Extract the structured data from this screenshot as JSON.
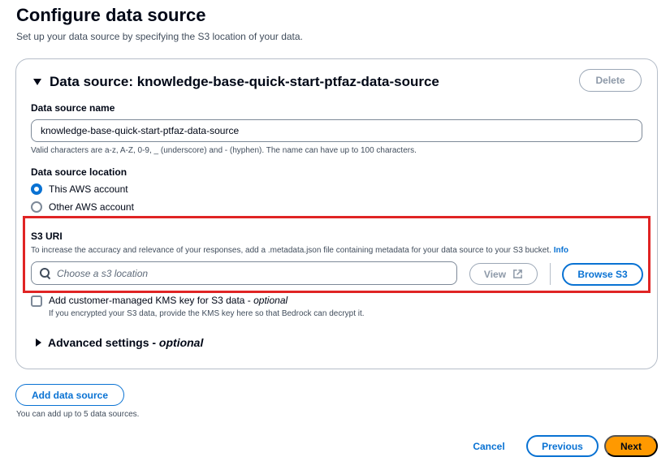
{
  "header": {
    "title": "Configure data source",
    "description": "Set up your data source by specifying the S3 location of your data."
  },
  "section": {
    "title": "Data source: knowledge-base-quick-start-ptfaz-data-source",
    "delete_label": "Delete",
    "expanded": true
  },
  "name_field": {
    "label": "Data source name",
    "value": "knowledge-base-quick-start-ptfaz-data-source",
    "hint": "Valid characters are a-z, A-Z, 0-9, _ (underscore) and - (hyphen). The name can have up to 100 characters."
  },
  "location": {
    "label": "Data source location",
    "options": [
      {
        "label": "This AWS account",
        "checked": true
      },
      {
        "label": "Other AWS account",
        "checked": false
      }
    ]
  },
  "s3": {
    "label": "S3 URI",
    "hint": "To increase the accuracy and relevance of your responses, add a .metadata.json file containing metadata for your data source to your S3 bucket.",
    "info_label": "Info",
    "placeholder": "Choose a s3 location",
    "view_label": "View",
    "browse_label": "Browse S3"
  },
  "kms": {
    "label": "Add customer-managed KMS key for S3 data - ",
    "optional": "optional",
    "hint": "If you encrypted your S3 data, provide the KMS key here so that Bedrock can decrypt it.",
    "checked": false
  },
  "advanced": {
    "label": "Advanced settings - ",
    "optional": "optional"
  },
  "add_source": {
    "label": "Add data source",
    "hint": "You can add up to 5 data sources."
  },
  "footer": {
    "cancel_label": "Cancel",
    "previous_label": "Previous",
    "next_label": "Next"
  },
  "colors": {
    "accent": "#0972d3",
    "primary_button": "#ff9900",
    "highlight_border": "#e02424"
  }
}
